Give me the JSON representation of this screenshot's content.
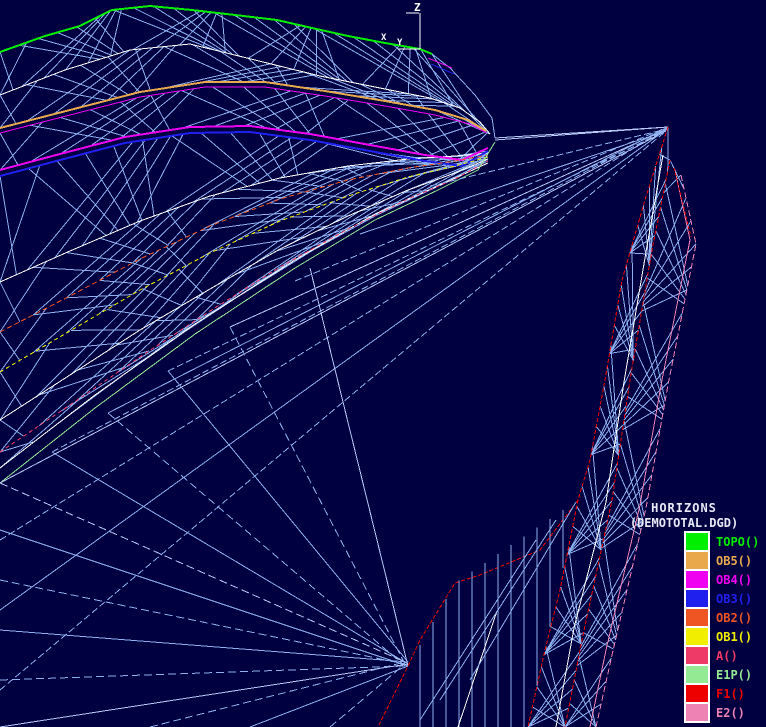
{
  "scene": {
    "background": "#000041",
    "mesh_color": "#8cb0f0",
    "mesh_bright": "#b6c9f7",
    "contour_color": "#ffffff"
  },
  "axis": {
    "z": "Z",
    "x": "X",
    "y": "Y"
  },
  "legend": {
    "title": "HORIZONS",
    "subtitle": "(DEMOTOTAL.DGD)",
    "items": [
      {
        "label": "TOPO()",
        "color": "#00ee00"
      },
      {
        "label": "OB5()",
        "color": "#eaa84c"
      },
      {
        "label": "OB4()",
        "color": "#f000f0"
      },
      {
        "label": "OB3()",
        "color": "#2020ee"
      },
      {
        "label": "OB2()",
        "color": "#ee5522"
      },
      {
        "label": "OB1()",
        "color": "#f2ee00"
      },
      {
        "label": "A()",
        "color": "#ee3a66"
      },
      {
        "label": "E1P()",
        "color": "#93ea93"
      },
      {
        "label": "F1()",
        "color": "#ee0000"
      },
      {
        "label": "E2()",
        "color": "#ee82b4"
      }
    ]
  }
}
